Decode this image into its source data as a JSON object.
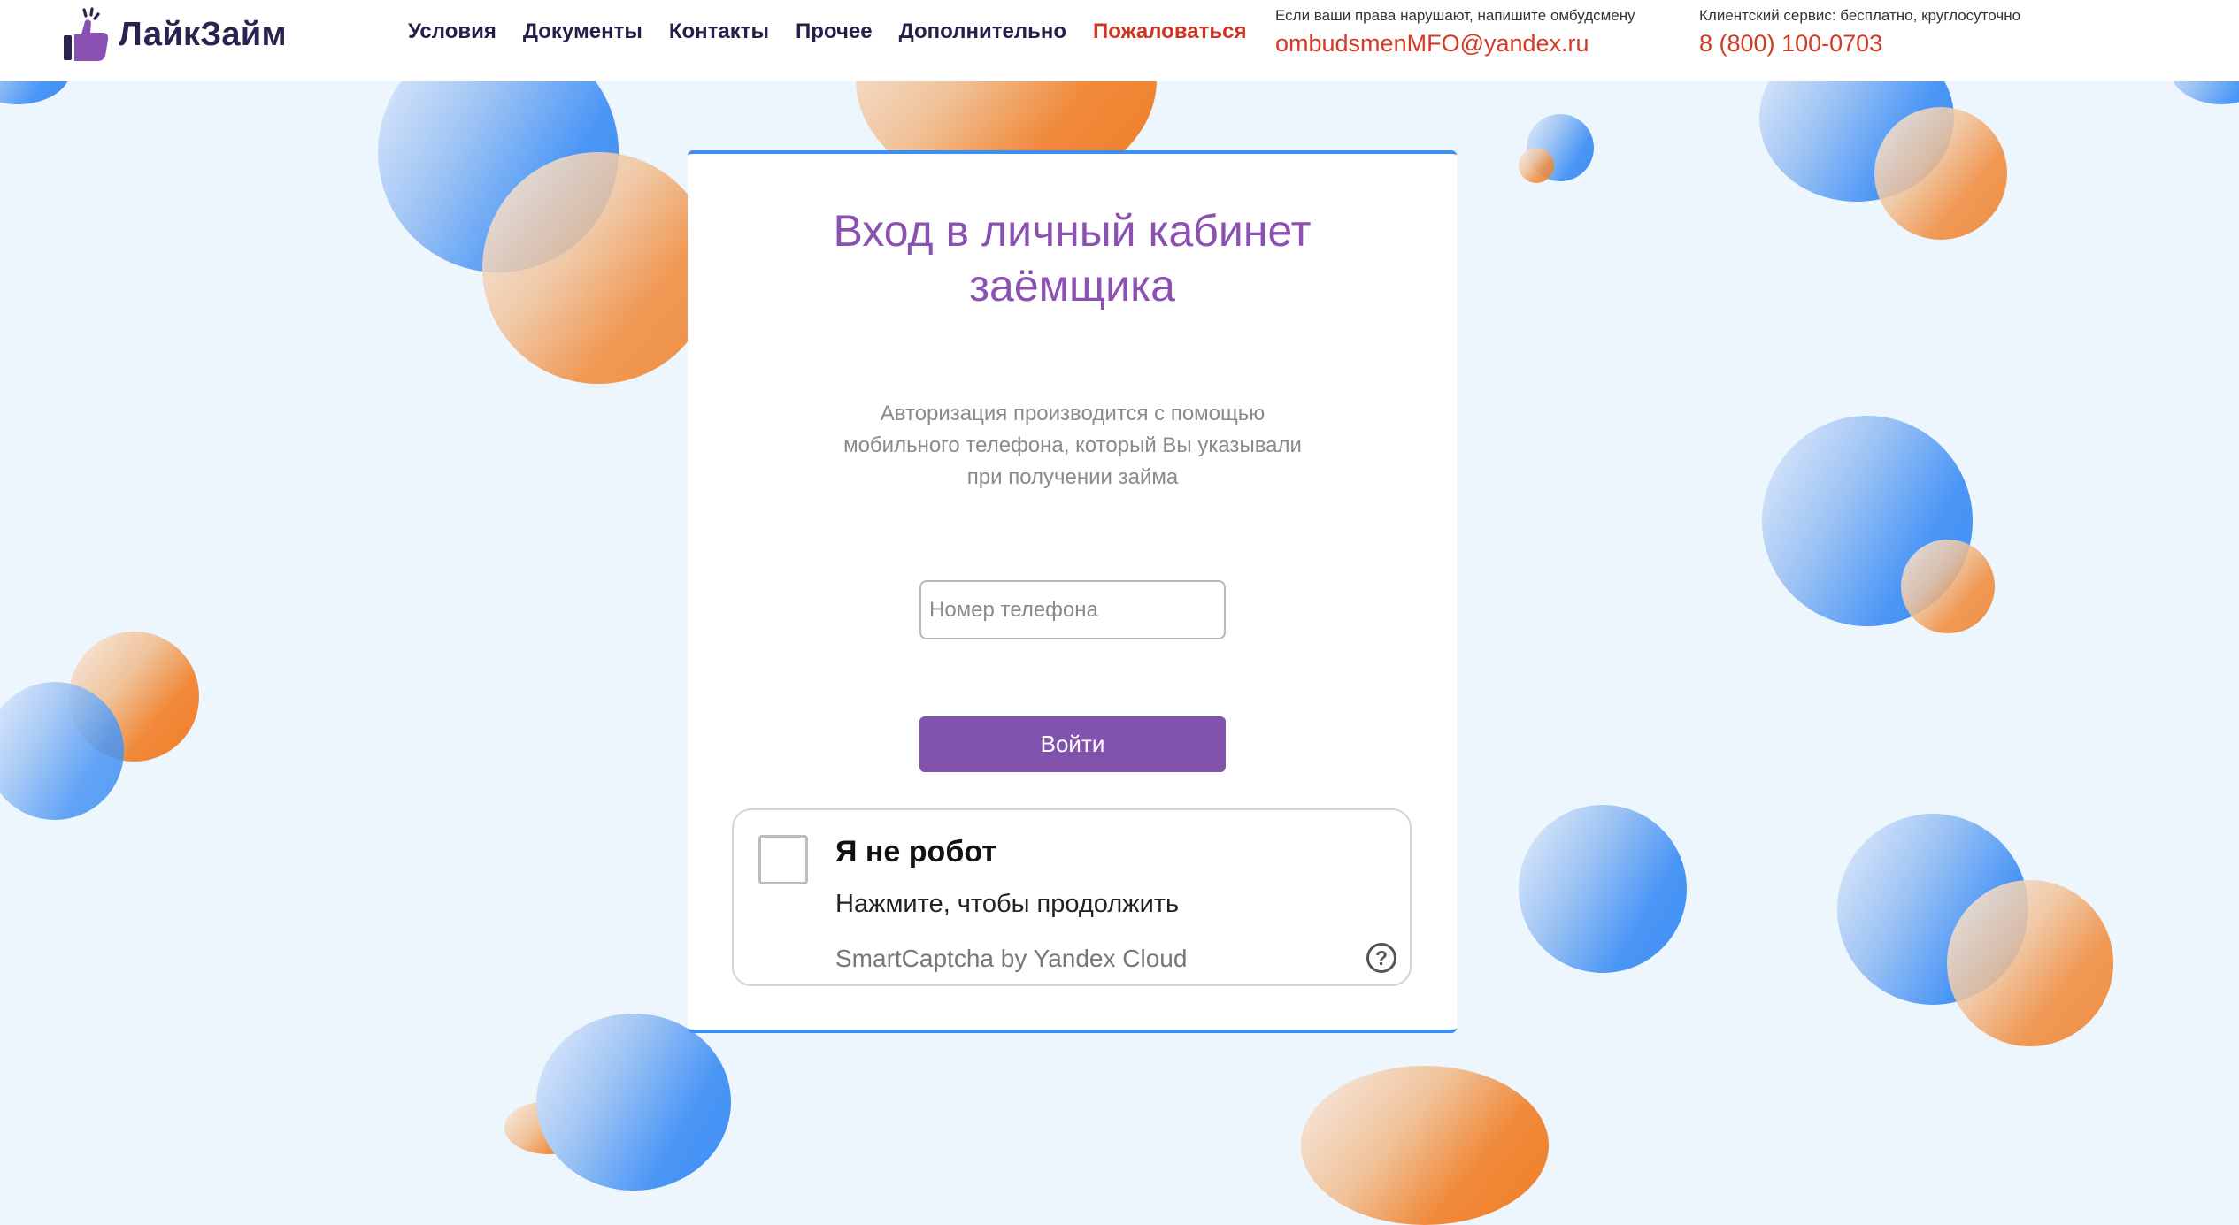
{
  "header": {
    "logo_text": "ЛайкЗайм",
    "nav": [
      {
        "label": "Условия"
      },
      {
        "label": "Документы"
      },
      {
        "label": "Контакты"
      },
      {
        "label": "Прочее"
      },
      {
        "label": "Дополнительно"
      },
      {
        "label": "Пожаловаться"
      }
    ],
    "ombudsman": {
      "hint": "Если ваши права нарушают, напишите омбудсмену",
      "email": "ombudsmenMFO@yandex.ru"
    },
    "service": {
      "hint": "Клиентский сервис: бесплатно, круглосуточно",
      "phone": "8 (800) 100-0703"
    }
  },
  "login": {
    "title_line1": "Вход в личный кабинет",
    "title_line2": "заёмщика",
    "desc_line1": "Авторизация производится с помощью",
    "desc_line2": "мобильного телефона, который Вы указывали",
    "desc_line3": "при получении займа",
    "phone_placeholder": "Номер телефона",
    "phone_value": "",
    "submit_label": "Войти"
  },
  "captcha": {
    "title": "Я не робот",
    "subtitle": "Нажмите, чтобы продолжить",
    "brand": "SmartCaptcha by Yandex Cloud",
    "help_glyph": "?",
    "checked": false
  },
  "colors": {
    "brand_purple": "#8253ad",
    "accent_red": "#d33a23",
    "card_border_blue": "#3e8ef0",
    "background": "#eef6fd"
  },
  "icons": {
    "logo": "thumbs-up-icon",
    "captcha_help": "question-circle-icon"
  }
}
